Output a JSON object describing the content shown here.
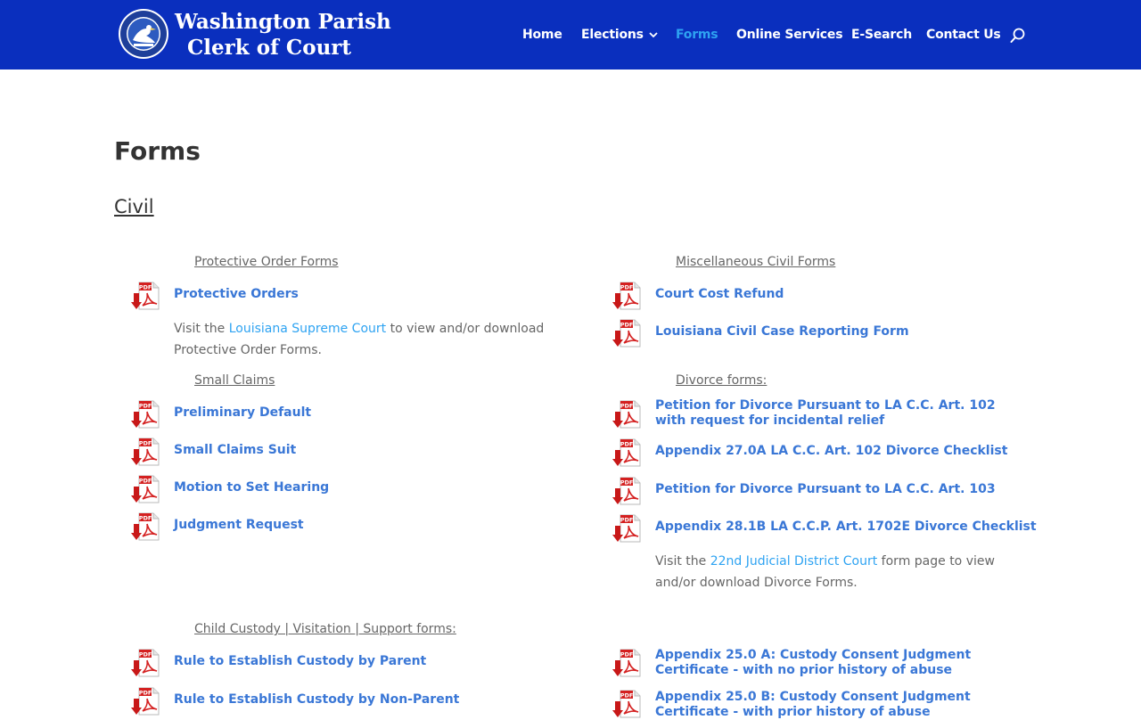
{
  "header": {
    "site_title_line1": "Washington Parish",
    "site_title_line2": "Clerk of Court",
    "colors": {
      "header_bg": "#0a2fbe",
      "active_nav": "#2ea3f2",
      "link": "#2a6cd3"
    }
  },
  "nav": {
    "items": [
      {
        "label": "Home"
      },
      {
        "label": "Elections"
      },
      {
        "label": "Forms"
      },
      {
        "label": "Online Services"
      },
      {
        "label": "E-Search"
      },
      {
        "label": "Contact Us"
      }
    ],
    "search_icon": "search-icon"
  },
  "page": {
    "title": "Forms",
    "section": "Civil"
  },
  "protective": {
    "heading": "Protective Order Forms",
    "links": [
      "Protective Orders"
    ],
    "note_before": "Visit the ",
    "note_link": "Louisiana Supreme Court",
    "note_after": " to view and/or download Protective Order Forms."
  },
  "misc": {
    "heading": "Miscellaneous Civil Forms",
    "links": [
      "Court Cost Refund",
      "Louisiana Civil Case Reporting Form"
    ]
  },
  "small_claims": {
    "heading": "Small Claims",
    "links": [
      "Preliminary Default",
      "Small Claims Suit",
      "Motion to Set Hearing",
      "Judgment Request"
    ]
  },
  "divorce": {
    "heading": "Divorce forms:",
    "links": [
      "Petition for Divorce Pursuant to LA C.C. Art. 102 with request for incidental relief",
      "Appendix 27.0A LA C.C. Art. 102 Divorce Checklist",
      "Petition for Divorce Pursuant to LA C.C. Art. 103",
      "Appendix 28.1B LA C.C.P. Art. 1702E Divorce Checklist"
    ],
    "note_before": "Visit the ",
    "note_link": "22nd Judicial District Court",
    "note_after": " form page to view and/or download Divorce Forms."
  },
  "custody": {
    "heading": "Child Custody | Visitation | Support forms:",
    "left_links": [
      "Rule to Establish Custody by Parent",
      "Rule to Establish Custody by Non-Parent"
    ],
    "right_links": [
      "Appendix 25.0 A: Custody Consent Judgment Certificate - with no prior history of abuse",
      "Appendix 25.0 B: Custody Consent Judgment Certificate - with prior history of abuse"
    ]
  },
  "icons": {
    "pdf": "pdf-download-icon",
    "logo": "louisiana-seal-logo"
  }
}
